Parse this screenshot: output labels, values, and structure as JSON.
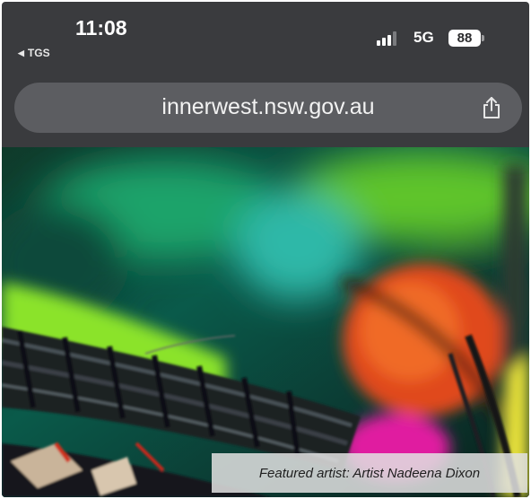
{
  "status_bar": {
    "time": "11:08",
    "back_app": "TGS",
    "back_icon": "back-triangle-icon",
    "network": "5G",
    "battery": "88",
    "signal_bars": 3,
    "signal_max": 4
  },
  "address_bar": {
    "url": "innerwest.nsw.gov.au",
    "share_icon": "share-icon"
  },
  "hero": {
    "caption": "Featured artist: Artist Nadeena Dixon"
  },
  "colors": {
    "chrome": "#3a3b3e",
    "address_bar": "#5c5d61",
    "text": "#ffffff"
  }
}
